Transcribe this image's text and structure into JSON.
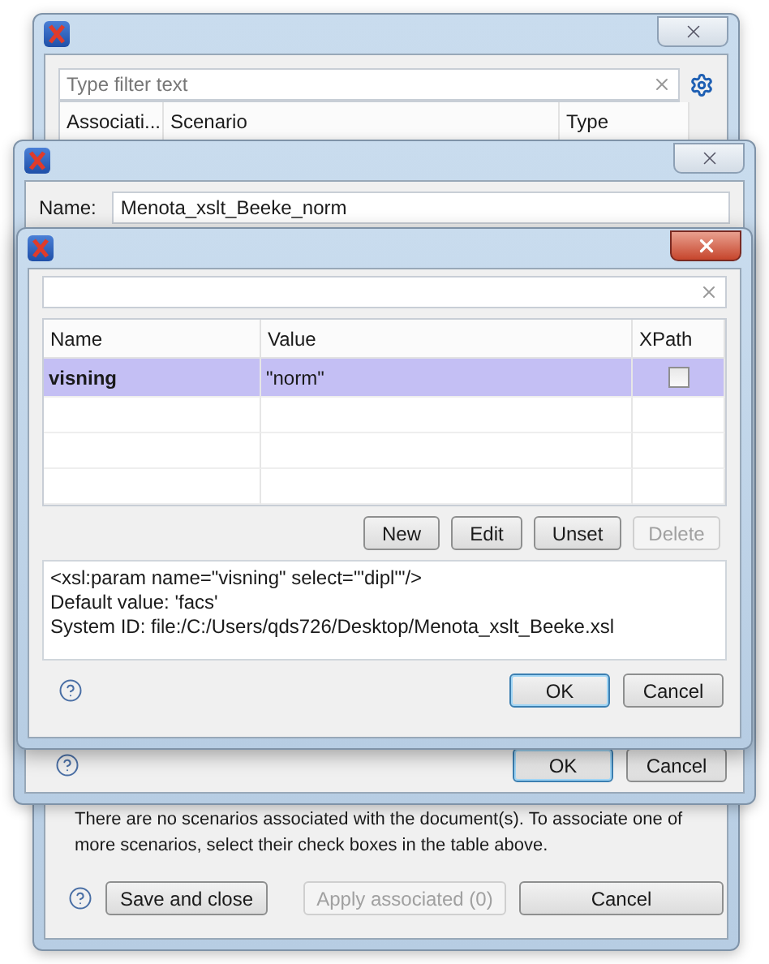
{
  "scenario_window": {
    "filter": {
      "placeholder": "Type filter text"
    },
    "columns": [
      "Associati...",
      "Scenario",
      "Type"
    ],
    "message_lines": [
      "There are no scenarios associated with the document(s). To associate one of",
      "more scenarios, select their check boxes in the table above."
    ],
    "buttons": [
      {
        "label": "Save and close",
        "disabled": false
      },
      {
        "label": "Apply associated (0)",
        "disabled": true
      },
      {
        "label": "Cancel",
        "disabled": false
      }
    ]
  },
  "edit_scenario_window": {
    "name_label": "Name:",
    "name_value": "Menota_xslt_Beeke_norm",
    "buttons": [
      {
        "label": "OK",
        "default": true
      },
      {
        "label": "Cancel",
        "default": false
      }
    ]
  },
  "parameters_window": {
    "columns": [
      "Name",
      "Value",
      "XPath"
    ],
    "rows": [
      {
        "name": "visning",
        "value": "\"norm\"",
        "xpath": false,
        "selected": true
      }
    ],
    "actions": [
      {
        "label": "New",
        "disabled": false
      },
      {
        "label": "Edit",
        "disabled": false
      },
      {
        "label": "Unset",
        "disabled": false
      },
      {
        "label": "Delete",
        "disabled": true
      }
    ],
    "description": [
      "<xsl:param name=\"visning\" select=\"'dipl'\"/>",
      "Default value: 'facs'",
      "System ID: file:/C:/Users/qds726/Desktop/Menota_xslt_Beeke.xsl"
    ],
    "buttons": [
      {
        "label": "OK",
        "default": true
      },
      {
        "label": "Cancel",
        "default": false
      }
    ]
  }
}
